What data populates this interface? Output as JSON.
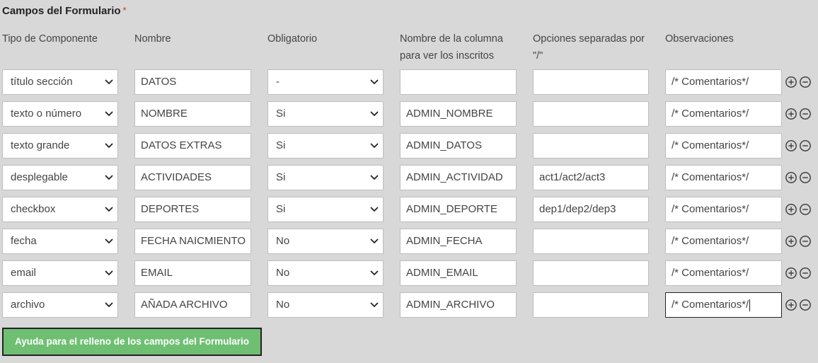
{
  "form": {
    "title": "Campos del Formulario",
    "required_mark": "*"
  },
  "headers": {
    "tipo": "Tipo de Componente",
    "nombre": "Nombre",
    "obligatorio": "Obligatorio",
    "columna_line1": "Nombre de la columna",
    "columna_line2": "para ver los inscritos",
    "opciones_line1": "Opciones separadas por",
    "opciones_line2": "\"/\"",
    "observaciones": "Observaciones"
  },
  "rows": [
    {
      "tipo": "título sección",
      "nombre": "DATOS",
      "obligatorio": "-",
      "columna": "",
      "opciones": "",
      "observaciones": "/* Comentarios*/"
    },
    {
      "tipo": "texto o número",
      "nombre": "NOMBRE",
      "obligatorio": "Si",
      "columna": "ADMIN_NOMBRE",
      "opciones": "",
      "observaciones": "/* Comentarios*/"
    },
    {
      "tipo": "texto grande",
      "nombre": "DATOS EXTRAS",
      "obligatorio": "Si",
      "columna": "ADMIN_DATOS",
      "opciones": "",
      "observaciones": "/* Comentarios*/"
    },
    {
      "tipo": "desplegable",
      "nombre": "ACTIVIDADES",
      "obligatorio": "Si",
      "columna": "ADMIN_ACTIVIDAD",
      "opciones": "act1/act2/act3",
      "observaciones": "/* Comentarios*/"
    },
    {
      "tipo": "checkbox",
      "nombre": "DEPORTES",
      "obligatorio": "Si",
      "columna": "ADMIN_DEPORTE",
      "opciones": "dep1/dep2/dep3",
      "observaciones": "/* Comentarios*/"
    },
    {
      "tipo": "fecha",
      "nombre": "FECHA NAICMIENTO",
      "obligatorio": "No",
      "columna": "ADMIN_FECHA",
      "opciones": "",
      "observaciones": "/* Comentarios*/"
    },
    {
      "tipo": "email",
      "nombre": "EMAIL",
      "obligatorio": "No",
      "columna": "ADMIN_EMAIL",
      "opciones": "",
      "observaciones": "/* Comentarios*/"
    },
    {
      "tipo": "archivo",
      "nombre": "AÑADA ARCHIVO",
      "obligatorio": "No",
      "columna": "ADMIN_ARCHIVO",
      "opciones": "",
      "observaciones": "/* Comentarios*/",
      "focused": true
    }
  ],
  "row_actions": {
    "add_icon": "plus-circle-icon",
    "remove_icon": "minus-circle-icon"
  },
  "help_button": {
    "label": "Ayuda para el relleno de los campos del Formulario"
  },
  "colors": {
    "background": "#d8d8d8",
    "help_button": "#6fbf73",
    "required": "#c0392b"
  }
}
